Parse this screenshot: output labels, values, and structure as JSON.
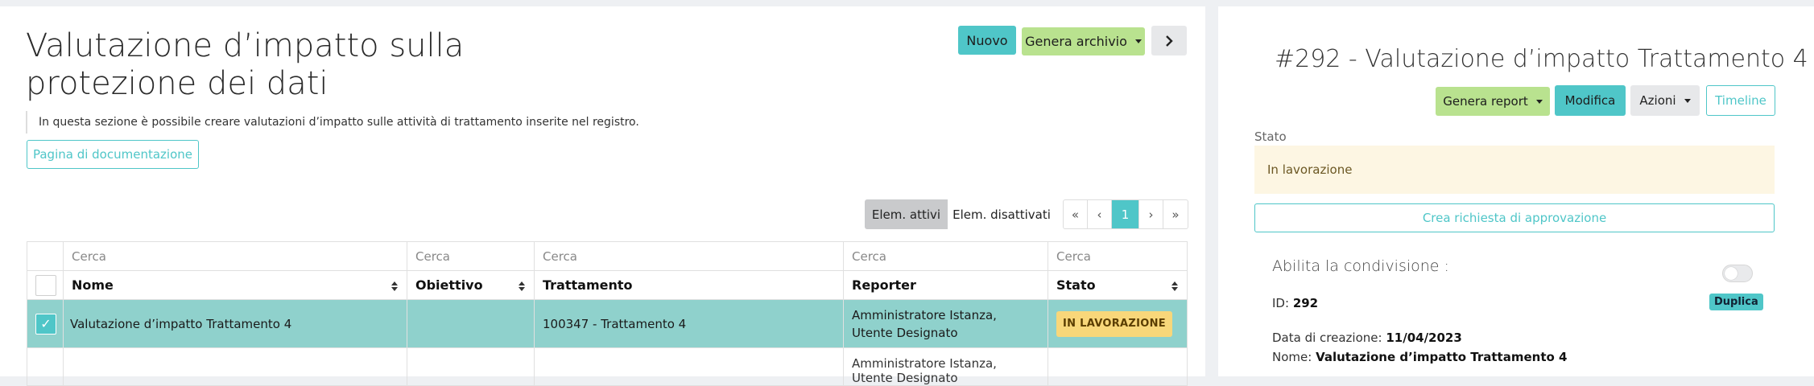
{
  "left": {
    "title": "Valutazione d’impatto sulla protezione dei dati",
    "intro": "In questa sezione è possibile creare valutazioni d’impatto sulle attività di trattamento inserite nel registro.",
    "doc_button": "Pagina di documentazione",
    "toolbar": {
      "new_label": "Nuovo",
      "archive_label": "Genera archivio",
      "next_icon": "chevron-right-icon"
    },
    "filters": {
      "active_label": "Elem. attivi",
      "inactive_label": "Elem. disattivati"
    },
    "pager": {
      "first": "«",
      "prev": "‹",
      "current": "1",
      "next": "›",
      "last": "»"
    },
    "table": {
      "search_placeholder": "Cerca",
      "columns": [
        "Nome",
        "Obiettivo",
        "Trattamento",
        "Reporter",
        "Stato"
      ],
      "rows": [
        {
          "nome": "Valutazione d’impatto Trattamento 4",
          "obiettivo": "",
          "trattamento": "100347 - Trattamento 4",
          "reporter": "Amministratore Istanza, Utente Designato",
          "stato": "IN LAVORAZIONE",
          "selected": true
        }
      ],
      "partial_row_reporter": "Amministratore Istanza, Utente Designato"
    }
  },
  "right": {
    "title": "#292 - Valutazione d’impatto Trattamento 4",
    "buttons": {
      "report_label": "Genera report",
      "edit_label": "Modifica",
      "actions_label": "Azioni",
      "timeline_label": "Timeline"
    },
    "stato_label": "Stato",
    "stato_value": "In lavorazione",
    "approval_button": "Crea richiesta di approvazione",
    "sharing_label": "Abilita la condivisione :",
    "id_label": "ID:",
    "id_value": "292",
    "duplicate_label": "Duplica",
    "created_label": "Data di creazione:",
    "created_value": "11/04/2023",
    "name_label": "Nome:",
    "name_value": "Valutazione d’impatto Trattamento 4"
  },
  "colors": {
    "accent": "#4fc6c8",
    "green_button": "#b9e28f",
    "selected_row": "#8fd1cc",
    "status_badge": "#f8d77a"
  }
}
